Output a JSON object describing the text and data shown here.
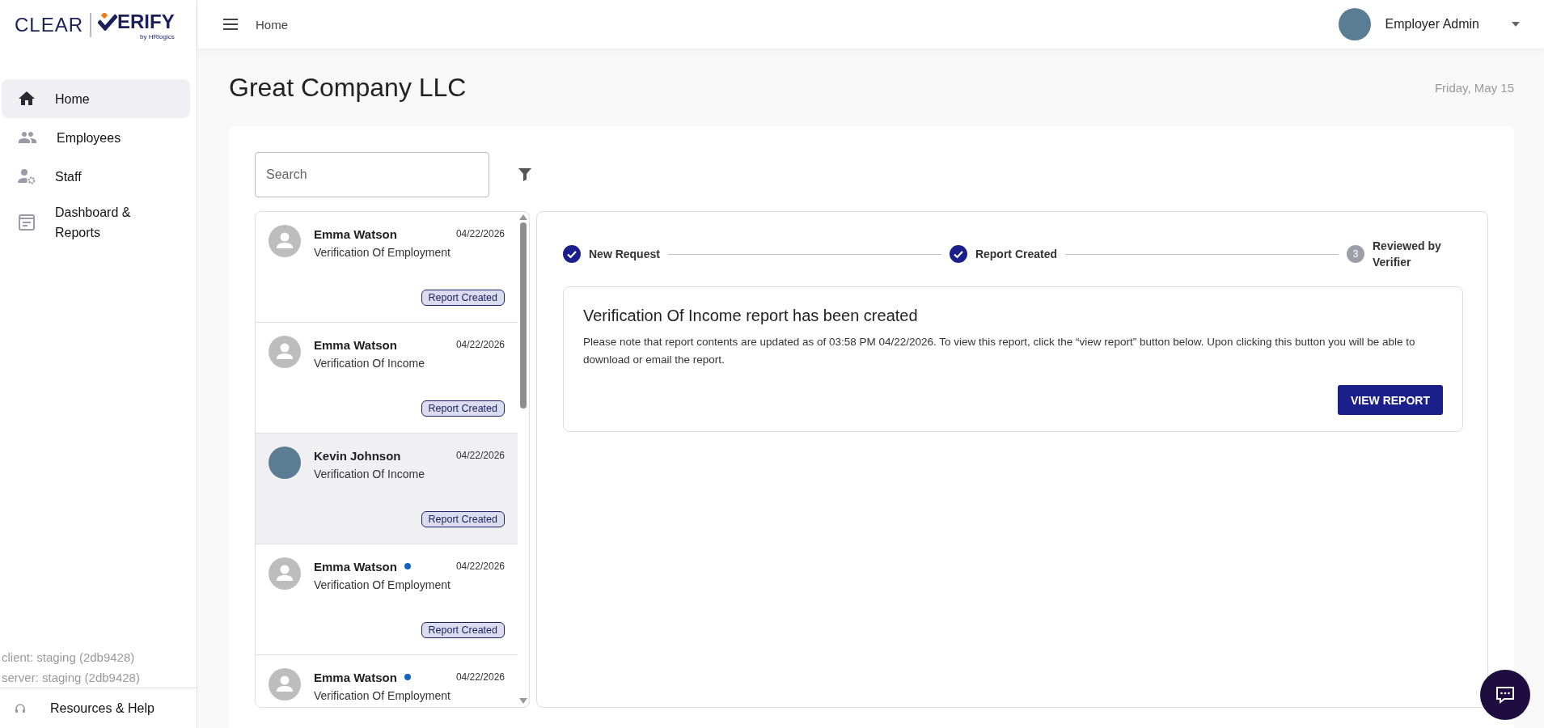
{
  "logo": {
    "left": "CLEAR",
    "right": "ERIFY",
    "byline": "by HRlogics"
  },
  "sidebar": {
    "items": [
      {
        "label": "Home",
        "kind": "home",
        "selected": true
      },
      {
        "label": "Employees",
        "kind": "people",
        "selected": false
      },
      {
        "label": "Staff",
        "kind": "staff",
        "selected": false
      },
      {
        "label": "Dashboard & Reports",
        "kind": "dashboard",
        "selected": false
      }
    ],
    "version_lines": [
      "client: staging (2db9428)",
      "server: staging (2db9428)"
    ],
    "help": "Resources & Help"
  },
  "topbar": {
    "breadcrumb": "Home",
    "user": "Employer Admin"
  },
  "page": {
    "title": "Great Company LLC",
    "date": "Friday, May 15"
  },
  "search": {
    "placeholder": "Search"
  },
  "requests": [
    {
      "name": "Emma Watson",
      "unread": false,
      "date": "04/22/2026",
      "type": "Verification Of Employment",
      "status": "Report Created",
      "kind": "default",
      "selected": false
    },
    {
      "name": "Emma Watson",
      "unread": false,
      "date": "04/22/2026",
      "type": "Verification Of Income",
      "status": "Report Created",
      "kind": "default",
      "selected": false
    },
    {
      "name": "Kevin Johnson",
      "unread": false,
      "date": "04/22/2026",
      "type": "Verification Of Income",
      "status": "Report Created",
      "kind": "photo",
      "selected": true
    },
    {
      "name": "Emma Watson",
      "unread": true,
      "date": "04/22/2026",
      "type": "Verification Of Employment",
      "status": "Report Created",
      "kind": "default",
      "selected": false
    },
    {
      "name": "Emma Watson",
      "unread": true,
      "date": "04/22/2026",
      "type": "Verification Of Employment",
      "kind": "default",
      "selected": false
    }
  ],
  "stepper": [
    {
      "label": "New Request",
      "completed": true
    },
    {
      "label": "Report Created",
      "completed": true
    },
    {
      "label": "Reviewed by Verifier",
      "completed": false,
      "number": "3"
    }
  ],
  "report": {
    "title": "Verification Of Income report has been created",
    "body": "Please note that report contents are updated as of 03:58 PM 04/22/2026. To view this report, click the “view report” button below. Upon clicking this button you will be able to download or email the report.",
    "button": "VIEW REPORT"
  }
}
